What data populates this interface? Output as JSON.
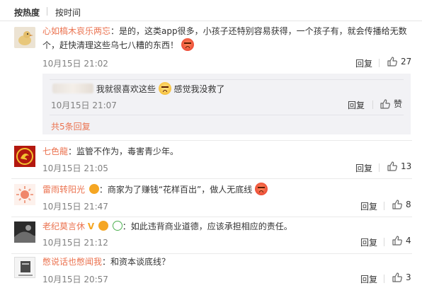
{
  "sort": {
    "hot": "按热度",
    "time": "按时间"
  },
  "comments": [
    {
      "user": "心如槁木哀乐两忘",
      "text1": "：是的，这类app很多，小孩子还特别容易获得，一个孩子有，就会传播给无数",
      "text2": "个，赶快清理这些乌七八糟的东西！",
      "time": "10月15日 21:02",
      "reply": "回复",
      "likes": "27",
      "sub": {
        "text_a": "我就很喜欢这些",
        "text_b": "感觉我没救了",
        "time": "10月15日 21:07",
        "reply": "回复",
        "like": "赞"
      },
      "more": "共5条回复"
    },
    {
      "user": "七色龍",
      "text": "：监管不作为，毒害青少年。",
      "time": "10月15日 21:05",
      "reply": "回复",
      "likes": "13"
    },
    {
      "user": "雷雨转阳光",
      "text_a": "：商家为了赚钱“花样百出”，做人无底线",
      "time": "10月15日 21:47",
      "reply": "回复",
      "likes": "8"
    },
    {
      "user": "老纪莫言休",
      "badge_v": "V",
      "text": "：如此违背商业道德，应该承担相应的责任。",
      "time": "10月15日 21:12",
      "reply": "回复",
      "likes": "4"
    },
    {
      "user": "憋说话也憋闻我",
      "text": "：和资本谈底线？",
      "time": "10月15日 20:57",
      "reply": "回复",
      "likes": "3"
    }
  ],
  "colors": {
    "username": "#eb7350",
    "time": "#808080",
    "reply_bg": "#f2f2f5"
  },
  "icons": [
    "thumbs-up-icon",
    "angry-emoji-icon",
    "crying-emoji-icon",
    "vip-badge-icon"
  ]
}
